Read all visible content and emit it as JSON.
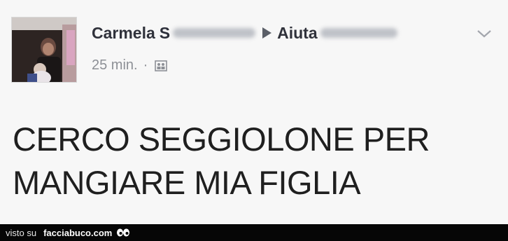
{
  "post": {
    "author": "Carmela",
    "author_suffix": "S",
    "group": "Aiuta",
    "time": "25 min.",
    "separator": "·",
    "audience_icon": "group-icon",
    "text_line1": "CERCO SEGGIOLONE PER",
    "text_line2": "MANGIARE MIA FIGLIA"
  },
  "footer": {
    "prefix": "visto su",
    "site": "facciabuco.com"
  },
  "colors": {
    "post_background": "#f7f7f7",
    "footer_background": "#060606",
    "meta_text": "#8d9096"
  }
}
